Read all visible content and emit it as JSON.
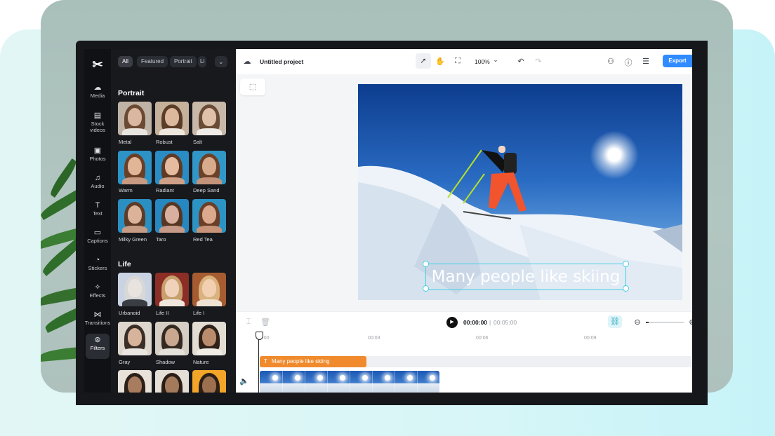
{
  "app": {
    "project_title": "Untitled project",
    "zoom_label": "100%",
    "export_label": "Export"
  },
  "sidebar": {
    "items": [
      {
        "label": "Media",
        "icon": "cloud-icon"
      },
      {
        "label": "Stock videos",
        "icon": "film-icon"
      },
      {
        "label": "Photos",
        "icon": "image-icon"
      },
      {
        "label": "Audio",
        "icon": "music-icon"
      },
      {
        "label": "Text",
        "icon": "text-icon"
      },
      {
        "label": "Captions",
        "icon": "captions-icon"
      },
      {
        "label": "Stickers",
        "icon": "sticker-icon"
      },
      {
        "label": "Effects",
        "icon": "sparkle-icon"
      },
      {
        "label": "Transitions",
        "icon": "bowtie-icon"
      },
      {
        "label": "Filters",
        "icon": "filters-icon",
        "active": true
      }
    ]
  },
  "filter_panel": {
    "chips": [
      "All",
      "Featured",
      "Portrait",
      "Li"
    ],
    "sections": [
      {
        "title": "Portrait",
        "items": [
          "Metal",
          "Robust",
          "Salt",
          "Warm",
          "Radiant",
          "Deep Sand",
          "Milky Green",
          "Taro",
          "Red Tea"
        ]
      },
      {
        "title": "Life",
        "items": [
          "Urbanoid",
          "Life II",
          "Life I",
          "Gray",
          "Shadow",
          "Nature"
        ]
      }
    ]
  },
  "canvas": {
    "caption_text": "Many people like skiing"
  },
  "timeline": {
    "current_time": "00:00:00",
    "separator": "|",
    "total_time": "00:05:00",
    "ruler_ticks": [
      "00:00",
      "00:03",
      "00:06",
      "00:09"
    ],
    "text_clip_label": "Many people like skiing"
  },
  "colors": {
    "accent": "#2f8bff",
    "text_clip": "#f08a2c",
    "selection": "#45d0e5",
    "panel_bg": "#17191d"
  }
}
